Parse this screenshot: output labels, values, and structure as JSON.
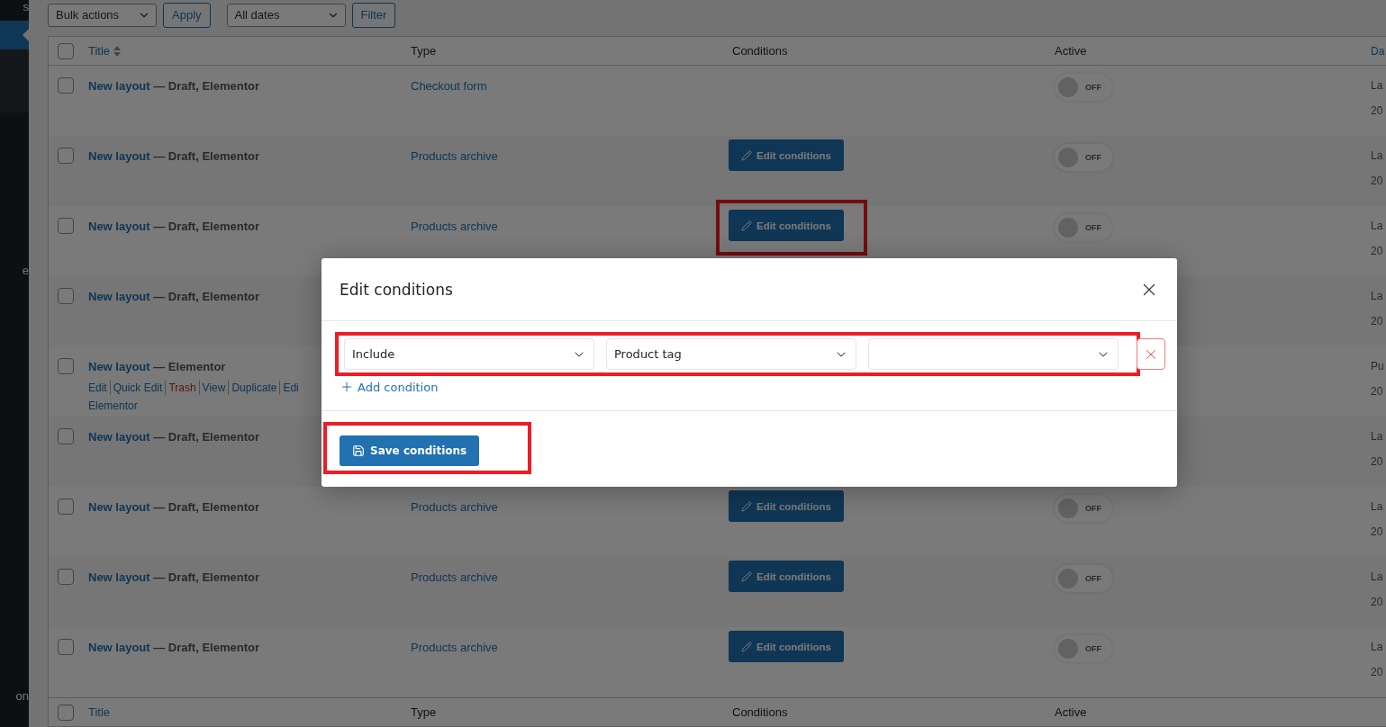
{
  "sidebar": {
    "items": [
      {
        "label": "s",
        "selected": false
      },
      {
        "selected": true
      },
      {
        "label": "e",
        "selected": false
      },
      {
        "label": "on",
        "selected": false
      }
    ]
  },
  "toolbar": {
    "bulk_actions": "Bulk actions",
    "apply": "Apply",
    "dates": "All dates",
    "filter": "Filter"
  },
  "table": {
    "select_all": {
      "checked": false
    },
    "columns": [
      "Title",
      "Type",
      "Conditions",
      "Active",
      "Da"
    ],
    "rows": [
      {
        "checked": false,
        "title": "New layout",
        "status": "— Draft, Elementor",
        "type": "Checkout form",
        "active": {
          "on": false,
          "label": "OFF"
        },
        "date": [
          "La",
          "20"
        ]
      },
      {
        "checked": false,
        "title": "New layout",
        "status": "— Draft, Elementor",
        "type": "Products archive",
        "conditions_button": {
          "label": "Edit conditions",
          "highlighted": false
        },
        "active": {
          "on": false,
          "label": "OFF"
        },
        "date": [
          "La",
          "20"
        ]
      },
      {
        "checked": false,
        "title": "New layout",
        "status": "— Draft, Elementor",
        "type": "Products archive",
        "conditions_button": {
          "label": "Edit conditions",
          "highlighted": true
        },
        "active": {
          "on": false,
          "label": "OFF"
        },
        "date": [
          "La",
          "20"
        ]
      },
      {
        "checked": false,
        "title": "New layout",
        "status": "— Draft, Elementor",
        "date": [
          "La",
          "20"
        ]
      },
      {
        "checked": false,
        "title": "New layout",
        "status": "— Elementor",
        "actions": [
          {
            "label": "Edit",
            "kind": "link"
          },
          {
            "label": "Quick Edit",
            "kind": "link"
          },
          {
            "label": "Trash",
            "kind": "danger"
          },
          {
            "label": "View",
            "kind": "link"
          },
          {
            "label": "Duplicate",
            "kind": "link"
          },
          {
            "label": "Edi",
            "kind": "link"
          }
        ],
        "actions_continued": "Elementor",
        "date": [
          "Pu",
          "20"
        ]
      },
      {
        "checked": false,
        "title": "New layout",
        "status": "— Draft, Elementor",
        "date": [
          "La",
          "20"
        ]
      },
      {
        "checked": false,
        "title": "New layout",
        "status": "— Draft, Elementor",
        "type": "Products archive",
        "conditions_button": {
          "label": "Edit conditions",
          "highlighted": false
        },
        "active": {
          "on": false,
          "label": "OFF"
        },
        "date": [
          "La",
          "20"
        ]
      },
      {
        "checked": false,
        "title": "New layout",
        "status": "— Draft, Elementor",
        "type": "Products archive",
        "conditions_button": {
          "label": "Edit conditions",
          "highlighted": false
        },
        "active": {
          "on": false,
          "label": "OFF"
        },
        "date": [
          "La",
          "20"
        ]
      },
      {
        "checked": false,
        "title": "New layout",
        "status": "— Draft, Elementor",
        "type": "Products archive",
        "conditions_button": {
          "label": "Edit conditions",
          "highlighted": false
        },
        "active": {
          "on": false,
          "label": "OFF"
        },
        "date": [
          "La",
          "20"
        ]
      }
    ],
    "footer_select_all": {
      "checked": false
    },
    "footer_columns": [
      "Title",
      "Type",
      "Conditions",
      "Active"
    ]
  },
  "dialog": {
    "title": "Edit conditions",
    "conditions": [
      {
        "selects": [
          {
            "kind": "select",
            "value": "Include"
          },
          {
            "kind": "select",
            "value": "Product tag"
          },
          {
            "kind": "select"
          }
        ],
        "highlighted": true
      }
    ],
    "add_condition": "Add condition",
    "save": {
      "label": "Save conditions",
      "highlighted": true
    }
  }
}
